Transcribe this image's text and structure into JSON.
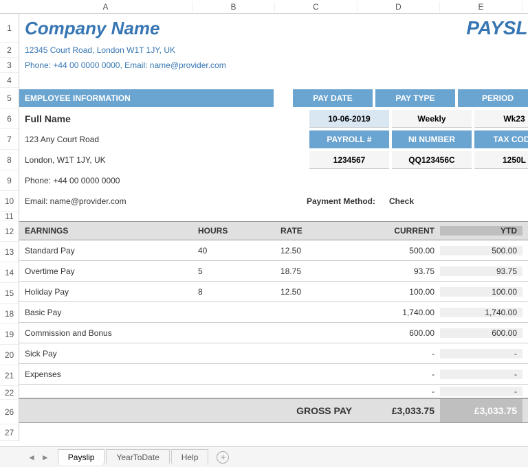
{
  "columns": {
    "a": "A",
    "b": "B",
    "c": "C",
    "d": "D",
    "e": "E"
  },
  "rows": [
    "1",
    "2",
    "3",
    "4",
    "5",
    "6",
    "7",
    "8",
    "9",
    "10",
    "11",
    "12",
    "13",
    "14",
    "15",
    "18",
    "19",
    "20",
    "21",
    "22",
    "26",
    "27"
  ],
  "header": {
    "company": "Company Name",
    "payslip": "PAYSLIP",
    "address": "12345 Court Road, London W1T 1JY, UK",
    "contact": "Phone: +44 00 0000 0000, Email: name@provider.com"
  },
  "emp_hdr": "EMPLOYEE INFORMATION",
  "emp": {
    "name": "Full Name",
    "addr1": "123 Any Court Road",
    "addr2": "London, W1T 1JY, UK",
    "phone": "Phone: +44 00 0000 0000",
    "email": "Email: name@provider.com"
  },
  "info": {
    "pay_date_h": "PAY DATE",
    "pay_date": "10-06-2019",
    "pay_type_h": "PAY TYPE",
    "pay_type": "Weekly",
    "period_h": "PERIOD",
    "period": "Wk23",
    "payroll_h": "PAYROLL #",
    "payroll": "1234567",
    "ni_h": "NI NUMBER",
    "ni": "QQ123456C",
    "tax_h": "TAX CODE",
    "tax": "1250L"
  },
  "payment": {
    "label": "Payment Method:",
    "value": "Check"
  },
  "table_hdr": {
    "earnings": "EARNINGS",
    "hours": "HOURS",
    "rate": "RATE",
    "current": "CURRENT",
    "ytd": "YTD"
  },
  "rows_data": [
    {
      "name": "Standard Pay",
      "hours": "40",
      "rate": "12.50",
      "current": "500.00",
      "ytd": "500.00"
    },
    {
      "name": "Overtime Pay",
      "hours": "5",
      "rate": "18.75",
      "current": "93.75",
      "ytd": "93.75"
    },
    {
      "name": "Holiday Pay",
      "hours": "8",
      "rate": "12.50",
      "current": "100.00",
      "ytd": "100.00"
    },
    {
      "name": "Basic Pay",
      "hours": "",
      "rate": "",
      "current": "1,740.00",
      "ytd": "1,740.00"
    },
    {
      "name": "Commission and Bonus",
      "hours": "",
      "rate": "",
      "current": "600.00",
      "ytd": "600.00"
    },
    {
      "name": "Sick Pay",
      "hours": "",
      "rate": "",
      "current": "-",
      "ytd": "-"
    },
    {
      "name": "Expenses",
      "hours": "",
      "rate": "",
      "current": "-",
      "ytd": "-"
    },
    {
      "name": "",
      "hours": "",
      "rate": "",
      "current": "-",
      "ytd": "-"
    }
  ],
  "gross": {
    "label": "GROSS PAY",
    "current": "£3,033.75",
    "ytd": "£3,033.75"
  },
  "tabs": {
    "t1": "Payslip",
    "t2": "YearToDate",
    "t3": "Help"
  }
}
